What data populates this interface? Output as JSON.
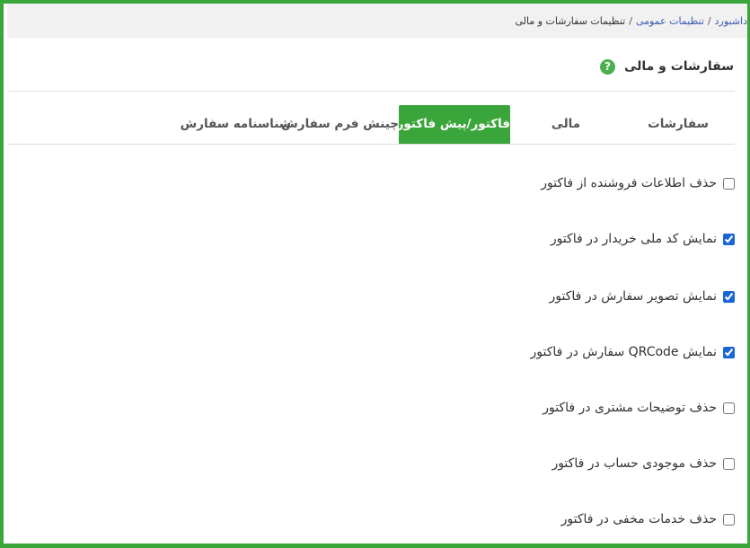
{
  "breadcrumb": {
    "items": [
      "داشبورد",
      "تنظیمات عمومی",
      "تنظیمات سفارشات و مالی"
    ],
    "separator": "/"
  },
  "header": {
    "title": "سفارشات و مالی",
    "help_icon": "?"
  },
  "tabs": [
    {
      "label": "سفارشات",
      "active": false
    },
    {
      "label": "مالی",
      "active": false
    },
    {
      "label": "فاکتور/پیش فاکتور",
      "active": true
    },
    {
      "label": "چینش فرم سفارش",
      "active": false
    },
    {
      "label": "شناسنامه سفارش",
      "active": false
    }
  ],
  "options": [
    {
      "label": "حذف اطلاعات فروشنده از فاکتور",
      "checked": false
    },
    {
      "label": "نمایش کد ملی خریدار در فاکتور",
      "checked": true
    },
    {
      "label": "نمایش تصویر سفارش در فاکتور",
      "checked": true
    },
    {
      "label": "نمایش QRCode سفارش در فاکتور",
      "checked": true
    },
    {
      "label": "حذف توضیحات مشتری در فاکتور",
      "checked": false
    },
    {
      "label": "حذف موجودی حساب در فاکتور",
      "checked": false
    },
    {
      "label": "حذف خدمات مخفی در فاکتور",
      "checked": false
    }
  ],
  "colors": {
    "accent": "#3aa53a",
    "link": "#3b5bb5",
    "checkbox": "#1a66d6"
  }
}
